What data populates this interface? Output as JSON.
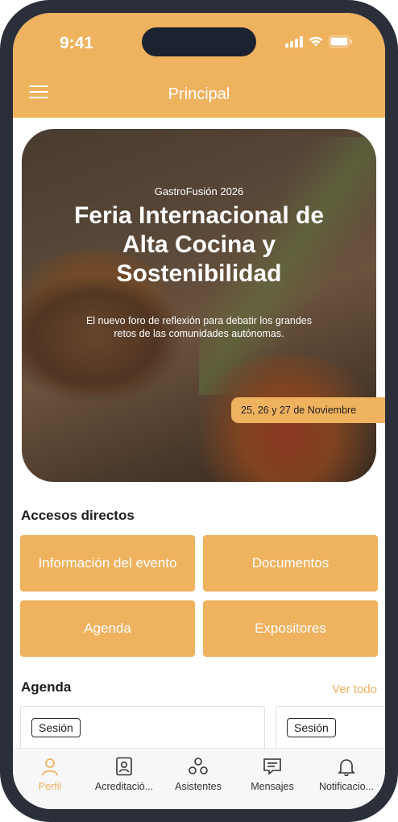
{
  "status_bar": {
    "time": "9:41"
  },
  "header": {
    "title": "Principal"
  },
  "hero": {
    "eyebrow": "GastroFusión 2026",
    "title": "Feria Internacional de Alta Cocina y Sostenibilidad",
    "description": "El nuevo foro de reflexión para debatir los grandes retos de las comunidades autónomas.",
    "date_badge": "25, 26 y 27 de Noviembre"
  },
  "shortcuts": {
    "title": "Accesos directos",
    "items": [
      {
        "label": "Información del evento"
      },
      {
        "label": "Documentos"
      },
      {
        "label": "Agenda"
      },
      {
        "label": "Expositores"
      }
    ]
  },
  "agenda": {
    "title": "Agenda",
    "see_all": "Ver todo",
    "cards": [
      {
        "tag": "Sesión"
      },
      {
        "tag": "Sesión"
      }
    ]
  },
  "tabbar": {
    "items": [
      {
        "label": "Perfil",
        "icon": "user-icon",
        "active": true
      },
      {
        "label": "Acreditació...",
        "icon": "badge-icon"
      },
      {
        "label": "Asistentes",
        "icon": "people-icon"
      },
      {
        "label": "Mensajes",
        "icon": "message-icon"
      },
      {
        "label": "Notificacio...",
        "icon": "bell-icon"
      }
    ]
  },
  "colors": {
    "accent": "#efb25e",
    "frame": "#2b2f3a"
  }
}
